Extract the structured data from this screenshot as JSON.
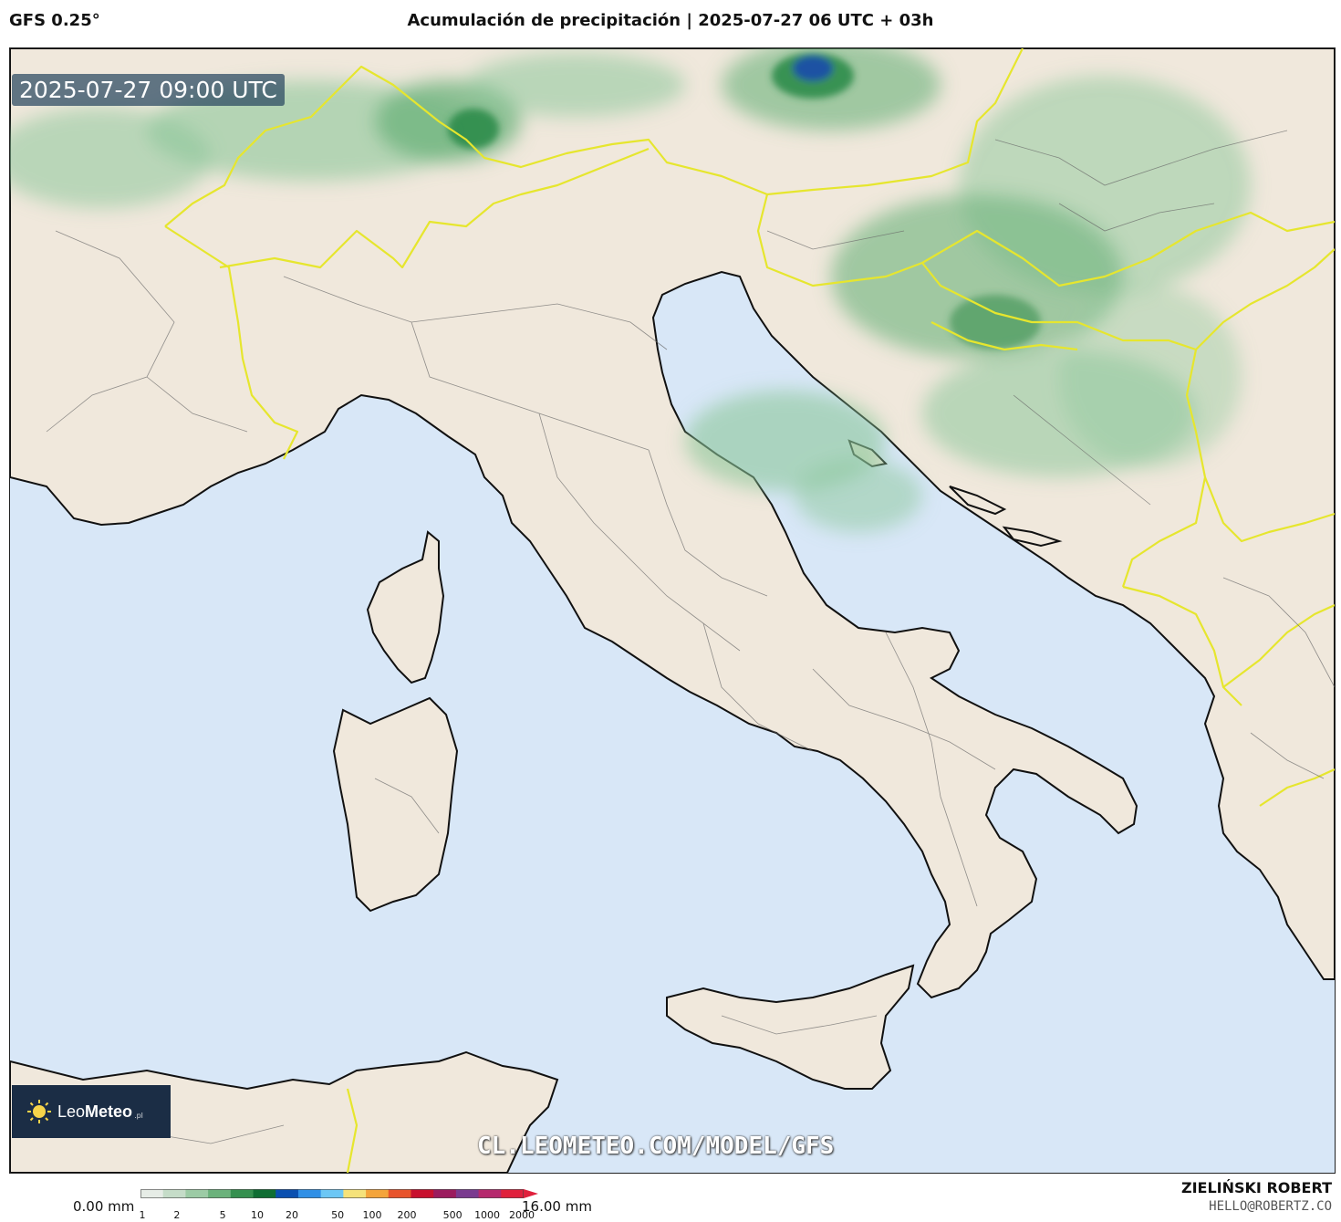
{
  "header": {
    "model": "GFS 0.25°",
    "title": "Acumulación de precipitación | 2025-07-27 06 UTC + 03h"
  },
  "map": {
    "valid_time": "2025-07-27 09:00 UTC",
    "watermark_url": "CL.LEOMETEO.COM/MODEL/GFS",
    "region": "Italy and surroundings",
    "colors": {
      "sea": "#d8e7f7",
      "land": "#f0e8dc",
      "country_border": "#e6e62e",
      "coast": "#111111",
      "precip_light": "#8cc79a",
      "precip_medium": "#3a9a55",
      "precip_heavy": "#1a4fa8"
    }
  },
  "logo": {
    "brand_plain": "Leo",
    "brand_bold": "Meteo",
    "brand_suffix": ".pl",
    "icon": "sun-icon"
  },
  "legend": {
    "min_label": "0.00 mm",
    "max_label": "16.00 mm",
    "ticks": [
      "1",
      "2",
      "5",
      "10",
      "20",
      "50",
      "100",
      "200",
      "500",
      "1000",
      "2000"
    ],
    "colors": [
      "#e6ece6",
      "#c5dcc8",
      "#9ccba5",
      "#6bb27b",
      "#35904f",
      "#0f6e33",
      "#0a4fb0",
      "#2f8fe6",
      "#6cc7f5",
      "#f5e27a",
      "#f4a43a",
      "#e8532b",
      "#c8102e",
      "#9b1b5e",
      "#7a3a8f",
      "#b5296d",
      "#e0203c"
    ]
  },
  "credits": {
    "author": "ZIELIŃSKI ROBERT",
    "email": "HELLO@ROBERTZ.CO"
  }
}
